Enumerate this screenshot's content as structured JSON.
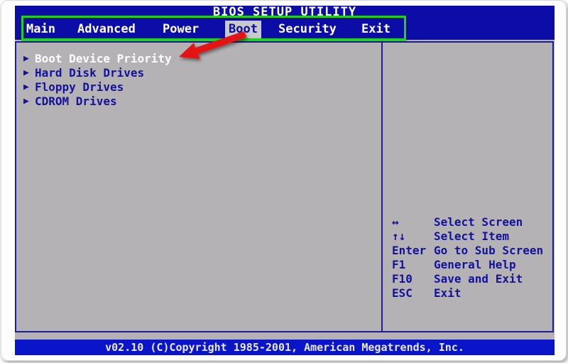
{
  "window": {
    "title": "BIOS SETUP UTILITY"
  },
  "menu_bar": {
    "items": [
      "Main",
      "Advanced",
      "Power",
      "Boot",
      "Security",
      "Exit"
    ],
    "selected": "Boot"
  },
  "boot_menu": {
    "bullet": "▶",
    "items": [
      "Boot Device Priority",
      "Hard Disk Drives",
      "Floppy Drives",
      "CDROM Drives"
    ],
    "selected": "Boot Device Priority"
  },
  "help_panel": {
    "rows": [
      {
        "key": "↔",
        "action": "Select Screen"
      },
      {
        "key": "↑↓",
        "action": "Select Item"
      },
      {
        "key": "Enter",
        "action": "Go to Sub Screen"
      },
      {
        "key": "F1",
        "action": "General Help"
      },
      {
        "key": "F10",
        "action": "Save and Exit"
      },
      {
        "key": "ESC",
        "action": "Exit"
      }
    ]
  },
  "footer": {
    "text": "v02.10 (C)Copyright 1985-2001, American Megatrends, Inc."
  },
  "annotations": {
    "highlight_target": "menu-bar",
    "arrow_target": "Boot Device Priority"
  },
  "colors": {
    "header_blue": "#0c0ca6",
    "footer_blue": "#0a14c8",
    "panel_gray": "#b4b2b4",
    "navy_text": "#12129e",
    "selected_tab_gray": "#c9c9c9",
    "annotation_green": "#1bd41b",
    "annotation_red": "#e51414"
  }
}
